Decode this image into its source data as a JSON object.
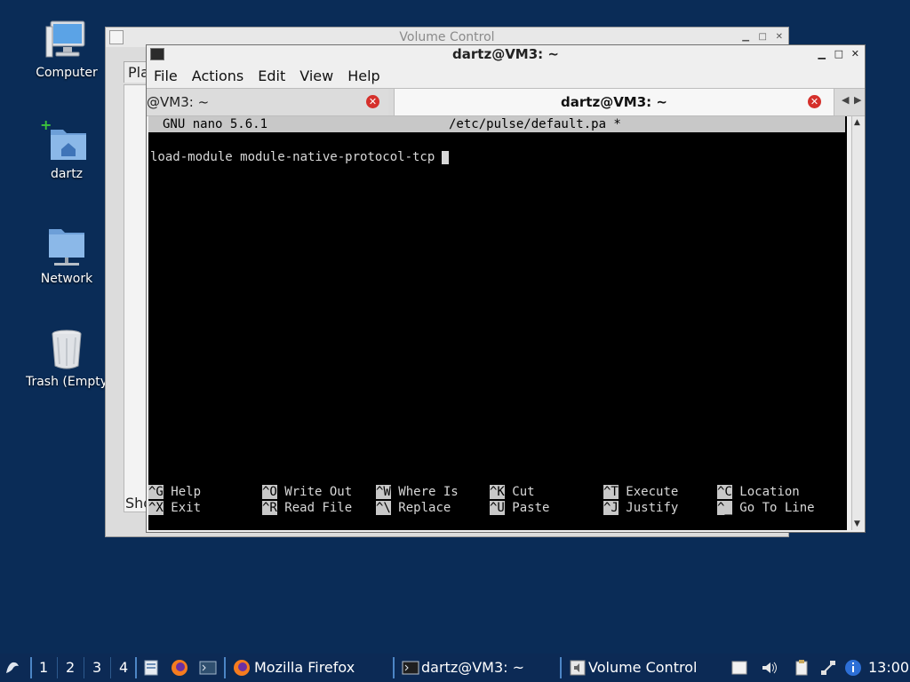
{
  "desktop": {
    "icons": [
      {
        "label": "Computer"
      },
      {
        "label": "dartz"
      },
      {
        "label": "Network"
      },
      {
        "label": "Trash (Empty"
      }
    ]
  },
  "volume_window": {
    "title": "Volume Control",
    "tab_label": "Pla",
    "footer_text": "Sho"
  },
  "terminal_window": {
    "title": "dartz@VM3: ~",
    "menu": [
      "File",
      "Actions",
      "Edit",
      "View",
      "Help"
    ],
    "tabs": [
      {
        "label": "@VM3: ~",
        "active": false
      },
      {
        "label": "dartz@VM3: ~",
        "active": true
      }
    ]
  },
  "nano": {
    "version": "GNU nano 5.6.1",
    "filename": "/etc/pulse/default.pa *",
    "content_line": "load-module module-native-protocol-tcp",
    "shortcuts_row1": [
      {
        "key": "^G",
        "label": "Help"
      },
      {
        "key": "^O",
        "label": "Write Out"
      },
      {
        "key": "^W",
        "label": "Where Is"
      },
      {
        "key": "^K",
        "label": "Cut"
      },
      {
        "key": "^T",
        "label": "Execute"
      },
      {
        "key": "^C",
        "label": "Location"
      }
    ],
    "shortcuts_row2": [
      {
        "key": "^X",
        "label": "Exit"
      },
      {
        "key": "^R",
        "label": "Read File"
      },
      {
        "key": "^\\",
        "label": "Replace"
      },
      {
        "key": "^U",
        "label": "Paste"
      },
      {
        "key": "^J",
        "label": "Justify"
      },
      {
        "key": "^_",
        "label": "Go To Line"
      }
    ]
  },
  "taskbar": {
    "workspaces": [
      "1",
      "2",
      "3",
      "4"
    ],
    "tasks": [
      {
        "label": "Mozilla Firefox"
      },
      {
        "label": "dartz@VM3: ~"
      },
      {
        "label": "Volume Control"
      }
    ],
    "clock": "13:00"
  },
  "colors": {
    "desktop_bg": "#0a2c57",
    "taskbar_bg": "#0c2a55",
    "nano_bar": "#c8c8c8",
    "tab_close": "#d5302b"
  }
}
